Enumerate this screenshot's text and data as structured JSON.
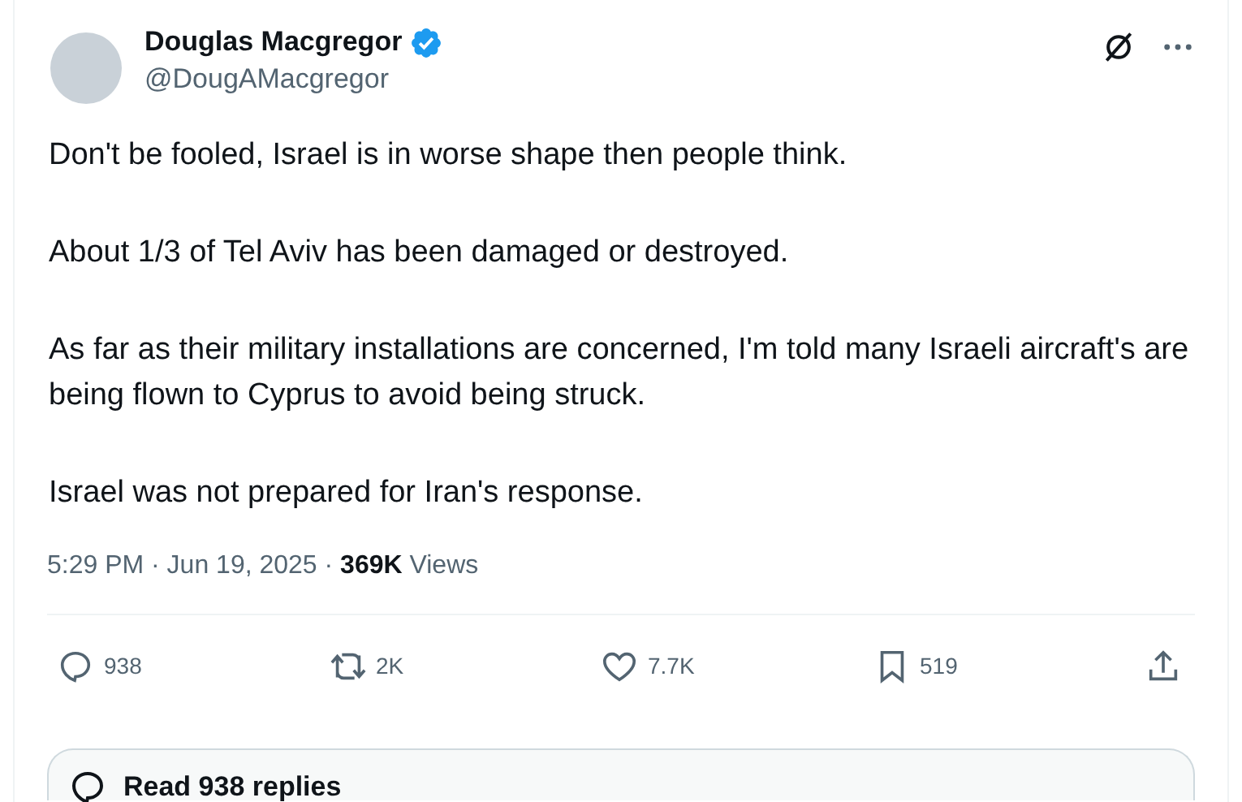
{
  "author": {
    "name": "Douglas Macgregor",
    "verified": true,
    "handle": "@DougAMacgregor"
  },
  "paragraphs": [
    "Don't be fooled, Israel is in worse shape then people think.",
    "About 1/3 of Tel Aviv has been damaged or destroyed.",
    "As far as their military installations are concerned, I'm told many Israeli aircraft's are being flown to Cyprus to avoid being struck.",
    "Israel was not prepared for Iran's response."
  ],
  "meta": "5:29 PM · Jun 19, 2025 · **369K** Views",
  "actions": [
    {
      "kind": "reply",
      "count": "938"
    },
    {
      "kind": "repost",
      "count": "2K"
    },
    {
      "kind": "like",
      "count": "7.7K"
    },
    {
      "kind": "bookmark",
      "count": "519"
    },
    {
      "kind": "share"
    }
  ],
  "replies_button": "Read 938 replies"
}
